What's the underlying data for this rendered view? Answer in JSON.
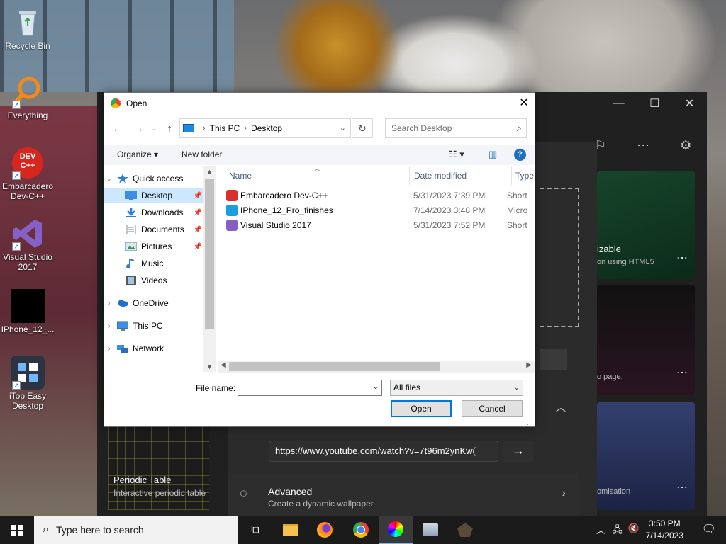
{
  "desktop": {
    "icons": [
      {
        "label": "Recycle Bin"
      },
      {
        "label": "Everything"
      },
      {
        "label": "Embarcadero Dev-C++"
      },
      {
        "label": "Visual Studio 2017"
      },
      {
        "label": "IPhone_12_..."
      },
      {
        "label": "iTop Easy Desktop"
      }
    ],
    "devcpp_logo_text": "DEV C++"
  },
  "background_app": {
    "card1_title": "izable",
    "card1_sub": "on using HTML5",
    "card2_sub": "o page.",
    "card3_sub": "omisation",
    "periodic_title": "Periodic Table",
    "periodic_sub": "Interactive periodic table",
    "url_value": "https://www.youtube.com/watch?v=7t96m2ynKw(",
    "advanced_title": "Advanced",
    "advanced_sub": "Create a dynamic wallpaper",
    "more_glyph": "⋯"
  },
  "dialog": {
    "title": "Open",
    "breadcrumb": [
      "This PC",
      "Desktop"
    ],
    "search_placeholder": "Search Desktop",
    "organize_label": "Organize ▾",
    "new_folder_label": "New folder",
    "nav": [
      {
        "label": "Quick access",
        "icon": "star-icon",
        "level": 0,
        "expand": "⌄"
      },
      {
        "label": "Desktop",
        "icon": "desktop-folder-icon",
        "level": 1,
        "pinned": true,
        "selected": true
      },
      {
        "label": "Downloads",
        "icon": "download-icon",
        "level": 1,
        "pinned": true
      },
      {
        "label": "Documents",
        "icon": "documents-icon",
        "level": 1,
        "pinned": true
      },
      {
        "label": "Pictures",
        "icon": "pictures-icon",
        "level": 1,
        "pinned": true
      },
      {
        "label": "Music",
        "icon": "music-icon",
        "level": 1
      },
      {
        "label": "Videos",
        "icon": "videos-icon",
        "level": 1
      },
      {
        "label": "OneDrive",
        "icon": "cloud-icon",
        "level": 0,
        "expand": "›"
      },
      {
        "label": "This PC",
        "icon": "computer-icon",
        "level": 0,
        "expand": "›"
      },
      {
        "label": "Network",
        "icon": "network-icon",
        "level": 0,
        "expand": "›"
      }
    ],
    "columns": {
      "name": "Name",
      "date": "Date modified",
      "type": "Type"
    },
    "files": [
      {
        "name": "Embarcadero Dev-C++",
        "date": "5/31/2023 7:39 PM",
        "type": "Short",
        "icon_color": "#d9302c"
      },
      {
        "name": "IPhone_12_Pro_finishes",
        "date": "7/14/2023 3:48 PM",
        "type": "Micro",
        "icon_color": "#1b9de2"
      },
      {
        "name": "Visual Studio 2017",
        "date": "5/31/2023 7:52 PM",
        "type": "Short",
        "icon_color": "#865fc5"
      }
    ],
    "file_name_label": "File name:",
    "file_name_value": "",
    "filter_value": "All files",
    "open_label": "Open",
    "cancel_label": "Cancel"
  },
  "taskbar": {
    "search_placeholder": "Type here to search",
    "time": "3:50 PM",
    "date": "7/14/2023"
  }
}
